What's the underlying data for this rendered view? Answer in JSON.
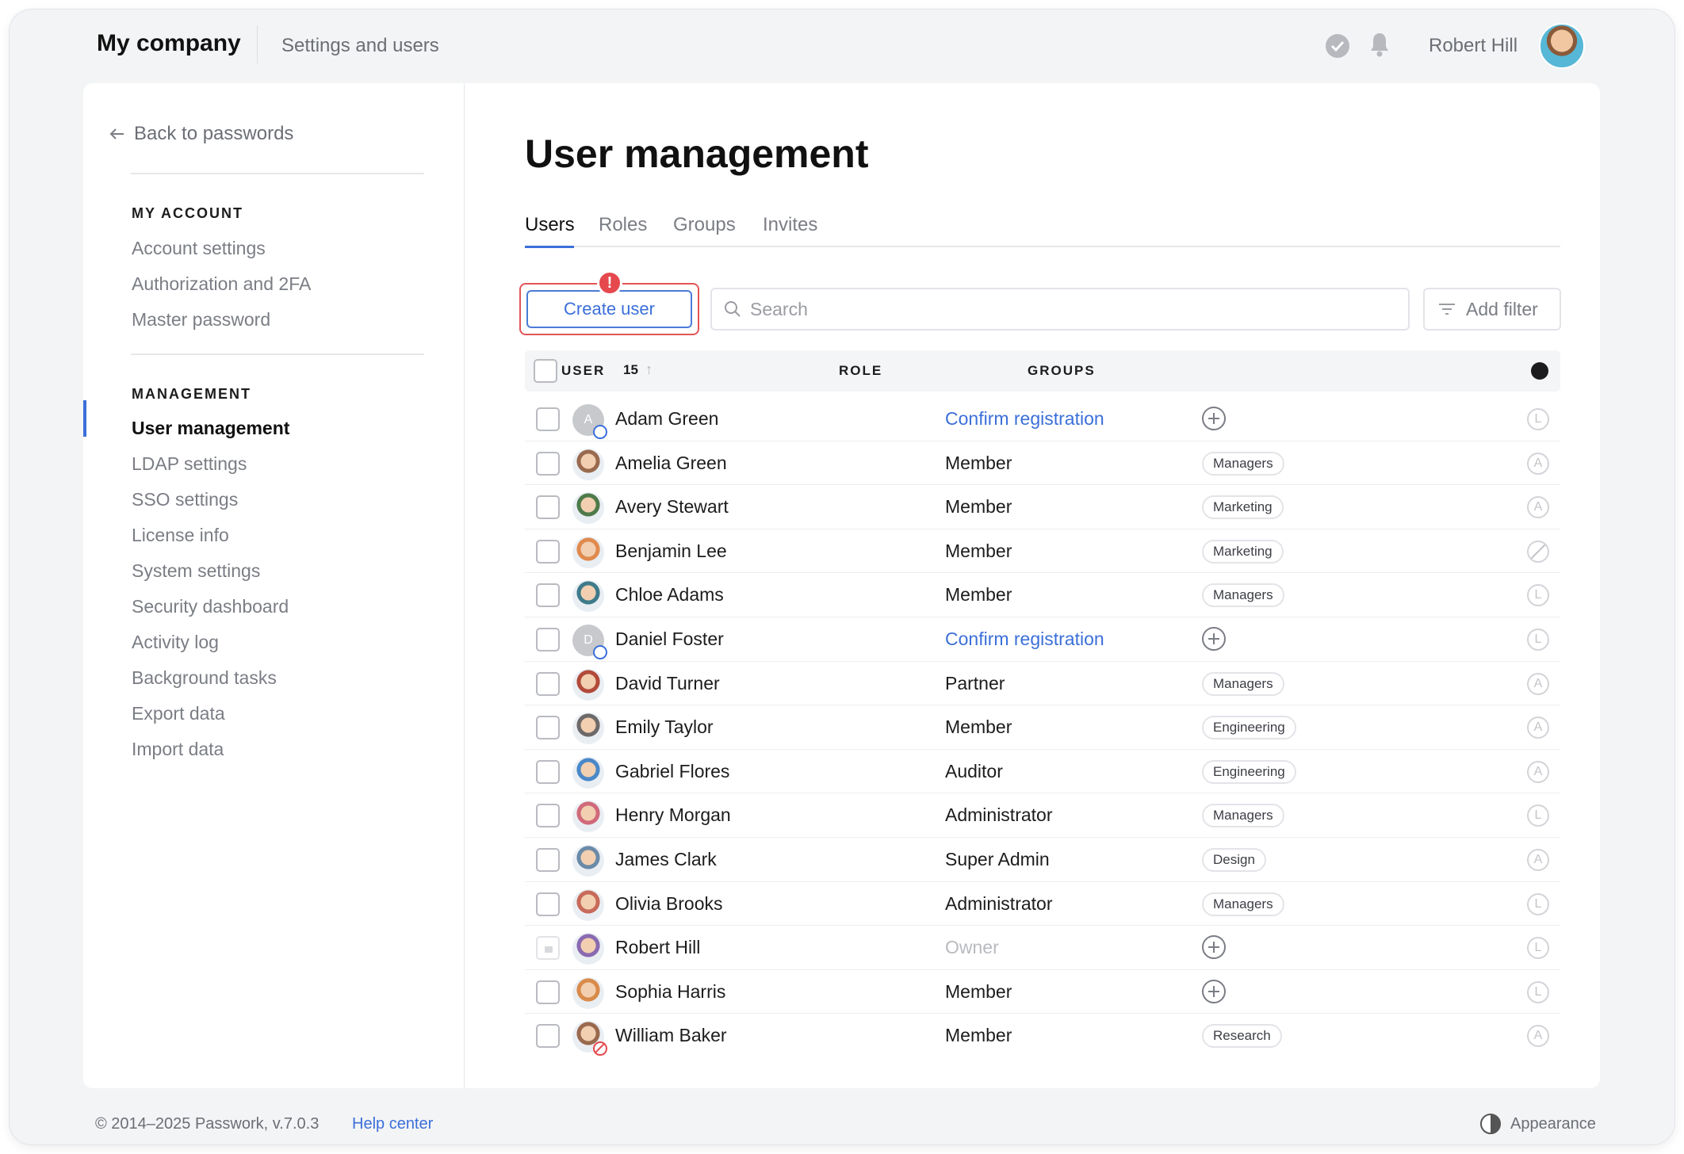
{
  "header": {
    "brand": "My company",
    "section": "Settings and users",
    "user_name": "Robert Hill",
    "icons": [
      "check-circle-icon",
      "bell-icon"
    ]
  },
  "sidebar": {
    "back_label": "Back to passwords",
    "my_account_heading": "MY ACCOUNT",
    "my_account_items": [
      "Account settings",
      "Authorization and 2FA",
      "Master password"
    ],
    "management_heading": "MANAGEMENT",
    "management_items": [
      "User management",
      "LDAP settings",
      "SSO settings",
      "License info",
      "System settings",
      "Security dashboard",
      "Activity log",
      "Background tasks",
      "Export data",
      "Import data"
    ],
    "active_item": "User management"
  },
  "main": {
    "title": "User management",
    "tabs": [
      "Users",
      "Roles",
      "Groups",
      "Invites"
    ],
    "active_tab": "Users",
    "create_button": "Create user",
    "alert_badge": "!",
    "search_placeholder": "Search",
    "filter_button": "Add filter",
    "columns": {
      "user": "USER",
      "user_count": "15",
      "role": "ROLE",
      "groups": "GROUPS"
    },
    "users": [
      {
        "name": "Adam Green",
        "initial": "A",
        "pending": true,
        "role": "Confirm registration",
        "role_style": "link",
        "group": "",
        "status": "L"
      },
      {
        "name": "Amelia Green",
        "role": "Member",
        "group": "Managers",
        "status": "A"
      },
      {
        "name": "Avery Stewart",
        "role": "Member",
        "group": "Marketing",
        "status": "A"
      },
      {
        "name": "Benjamin Lee",
        "role": "Member",
        "group": "Marketing",
        "status": "none"
      },
      {
        "name": "Chloe Adams",
        "role": "Member",
        "group": "Managers",
        "status": "L"
      },
      {
        "name": "Daniel Foster",
        "initial": "D",
        "pending": true,
        "role": "Confirm registration",
        "role_style": "link",
        "group": "",
        "status": "L"
      },
      {
        "name": "David Turner",
        "role": "Partner",
        "group": "Managers",
        "status": "A"
      },
      {
        "name": "Emily Taylor",
        "role": "Member",
        "group": "Engineering",
        "status": "A"
      },
      {
        "name": "Gabriel Flores",
        "role": "Auditor",
        "group": "Engineering",
        "status": "A"
      },
      {
        "name": "Henry Morgan",
        "role": "Administrator",
        "group": "Managers",
        "status": "L"
      },
      {
        "name": "James Clark",
        "role": "Super Admin",
        "group": "Design",
        "status": "A"
      },
      {
        "name": "Olivia Brooks",
        "role": "Administrator",
        "group": "Managers",
        "status": "L"
      },
      {
        "name": "Robert Hill",
        "role": "Owner",
        "role_style": "muted",
        "locked": true,
        "group": "",
        "status": "L"
      },
      {
        "name": "Sophia Harris",
        "role": "Member",
        "group": "",
        "status": "L"
      },
      {
        "name": "William Baker",
        "blocked": true,
        "role": "Member",
        "group": "Research",
        "status": "A"
      }
    ]
  },
  "footer": {
    "copyright": "© 2014–2025 Passwork, v.7.0.3",
    "help": "Help center",
    "appearance": "Appearance"
  },
  "colors": {
    "accent": "#3b6fd9",
    "alert": "#e5484d"
  }
}
